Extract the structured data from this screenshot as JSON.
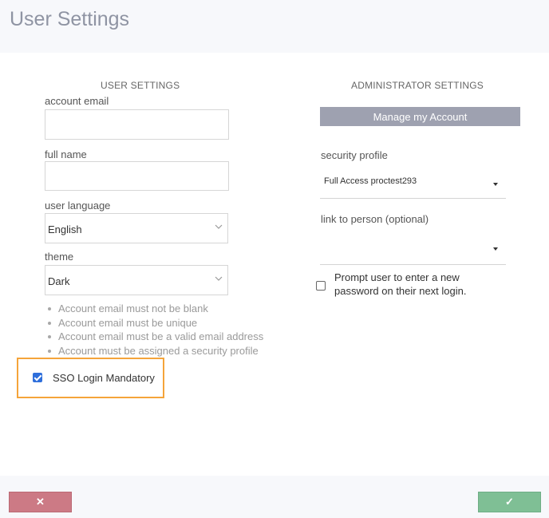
{
  "page": {
    "title": "User Settings"
  },
  "user_settings": {
    "heading": "USER SETTINGS",
    "account_email": {
      "label": "account email",
      "value": ""
    },
    "full_name": {
      "label": "full name",
      "value": ""
    },
    "user_language": {
      "label": "user language",
      "value": "English"
    },
    "theme": {
      "label": "theme",
      "value": "Dark"
    },
    "validation": [
      "Account email must not be blank",
      "Account email must be unique",
      "Account email must be a valid email address",
      "Account must be assigned a security profile"
    ],
    "sso": {
      "label": "SSO Login Mandatory",
      "checked": true
    }
  },
  "admin_settings": {
    "heading": "ADMINISTRATOR SETTINGS",
    "manage_button": "Manage my Account",
    "security_profile": {
      "label": "security profile",
      "value": "Full Access proctest293"
    },
    "link_person": {
      "label": "link to person (optional)",
      "value": ""
    },
    "prompt_password": {
      "label": "Prompt user to enter a new password on their next login.",
      "checked": false
    }
  },
  "footer": {
    "cancel_icon": "✕",
    "confirm_icon": "✓"
  },
  "colors": {
    "accent_highlight": "#f5a43a",
    "cancel": "#cc7a85",
    "confirm": "#7fbf95",
    "manage_button": "#9ea1b0",
    "checkbox": "#2f6fdb"
  }
}
